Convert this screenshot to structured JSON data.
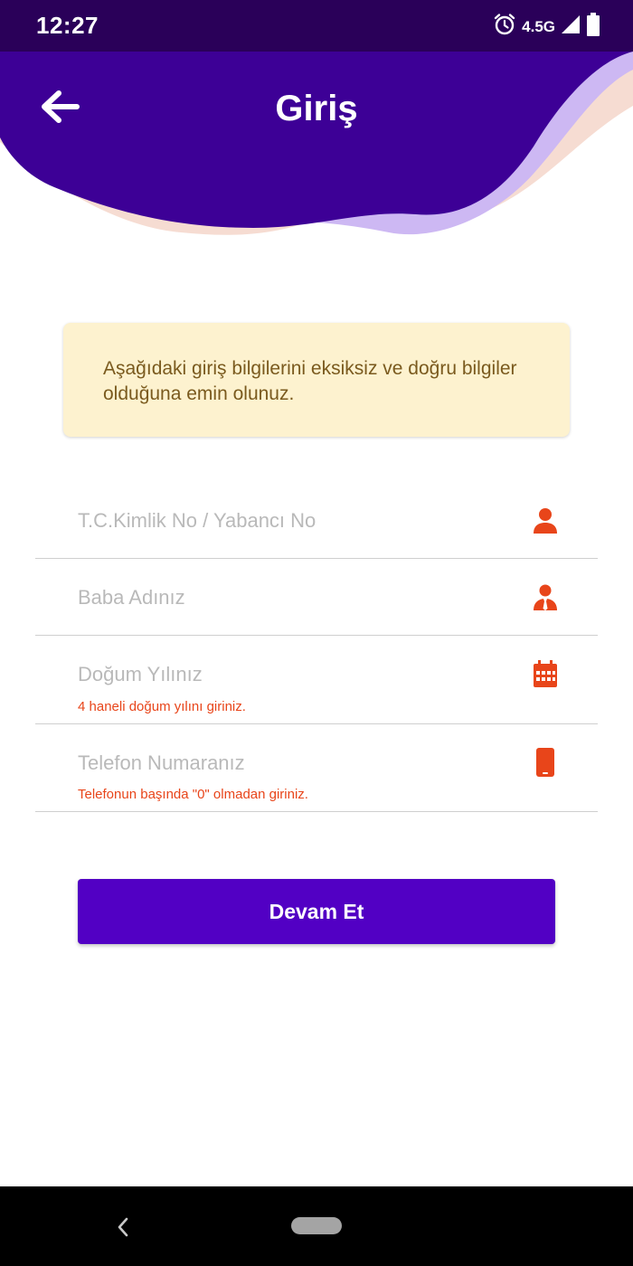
{
  "status_bar": {
    "time": "12:27",
    "network": "4.5G",
    "icons": [
      "alarm-icon",
      "signal-icon",
      "battery-icon"
    ]
  },
  "header": {
    "title": "Giriş",
    "back_icon": "arrow-left-icon",
    "colors": {
      "primary": "#3d0096",
      "wave_light": "#cdb8f3",
      "wave_peach": "#f6dcd2"
    }
  },
  "notice": {
    "text": "Aşağıdaki giriş bilgilerini eksiksiz ve doğru bilgiler olduğuna emin olunuz."
  },
  "form": {
    "fields": [
      {
        "placeholder": "T.C.Kimlik No / Yabancı No",
        "value": "",
        "icon": "user-icon",
        "hint": ""
      },
      {
        "placeholder": "Baba Adınız",
        "value": "",
        "icon": "man-with-tie-icon",
        "hint": ""
      },
      {
        "placeholder": "Doğum Yılınız",
        "value": "",
        "icon": "calendar-icon",
        "hint": "4 haneli doğum yılını giriniz."
      },
      {
        "placeholder": "Telefon Numaranız",
        "value": "",
        "icon": "mobile-phone-icon",
        "hint": "Telefonun başında \"0\" olmadan giriniz."
      }
    ],
    "icon_color": "#e8451a",
    "submit_label": "Devam Et",
    "submit_color": "#5200c4"
  },
  "nav_bar": {
    "icons": [
      "nav-back-icon",
      "nav-home-pill-icon"
    ]
  }
}
